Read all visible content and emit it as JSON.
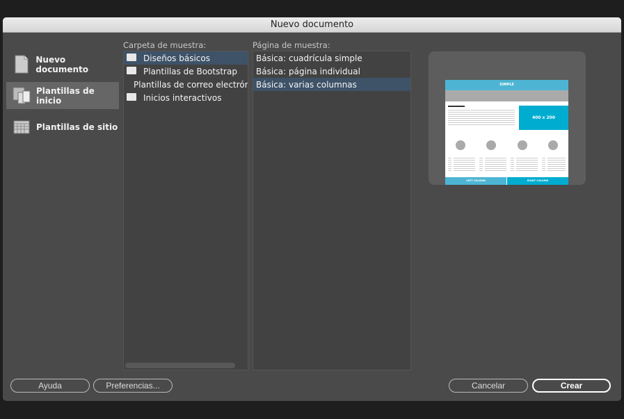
{
  "window": {
    "title": "Nuevo documento"
  },
  "sidebar": {
    "items": [
      {
        "label": "Nuevo documento",
        "icon": "document-icon",
        "selected": false
      },
      {
        "label": "Plantillas de inicio",
        "icon": "templates-icon",
        "selected": true
      },
      {
        "label": "Plantillas de sitio",
        "icon": "site-grid-icon",
        "selected": false
      }
    ]
  },
  "folders": {
    "label": "Carpeta de muestra:",
    "items": [
      {
        "label": "Diseños básicos",
        "selected": true
      },
      {
        "label": "Plantillas de Bootstrap",
        "selected": false
      },
      {
        "label": "Plantillas de correo electróni",
        "selected": false
      },
      {
        "label": "Inicios interactivos",
        "selected": false
      }
    ]
  },
  "pages": {
    "label": "Página de muestra:",
    "items": [
      {
        "label": "Básica: cuadrícula simple",
        "selected": false
      },
      {
        "label": "Básica: página individual",
        "selected": false
      },
      {
        "label": "Básica: varias columnas",
        "selected": true
      }
    ]
  },
  "preview": {
    "header": "SIMPLE",
    "image_label": "400 x 200",
    "left_column": "LEFT COLUMN",
    "right_column": "RIGHT COLUMN",
    "accent": "#4db5d3"
  },
  "buttons": {
    "help": "Ayuda",
    "preferences": "Preferencias...",
    "cancel": "Cancelar",
    "create": "Crear"
  }
}
